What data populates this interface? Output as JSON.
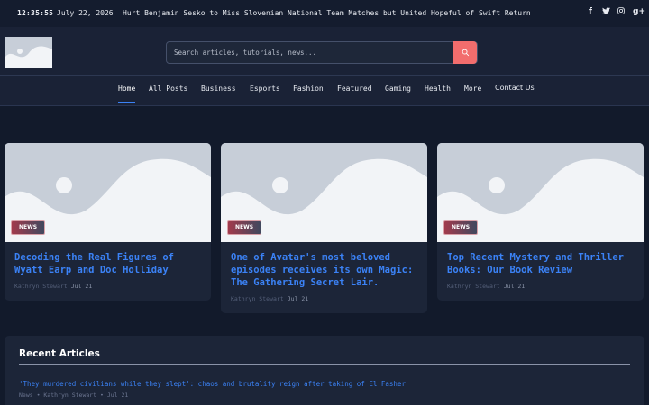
{
  "topbar": {
    "clock": "12:35:55",
    "date": "July 22, 2026",
    "ticker": "Hurt Benjamin Sesko to Miss Slovenian National Team Matches but United Hopeful of Swift Return",
    "social": [
      "f",
      "t",
      "ig",
      "g+"
    ]
  },
  "search": {
    "placeholder": "Search articles, tutorials, news..."
  },
  "nav": {
    "items": [
      "Home",
      "All Posts",
      "Business",
      "Esports",
      "Fashion",
      "Featured",
      "Gaming",
      "Health",
      "More",
      "Contact Us"
    ],
    "active": "Home"
  },
  "cards": [
    {
      "badge": "NEWS",
      "title": "Decoding the Real Figures of Wyatt Earp and Doc Holliday",
      "author": "Kathryn Stewart",
      "date": "Jul 21"
    },
    {
      "badge": "NEWS",
      "title": "One of Avatar's most beloved episodes receives its own Magic: The Gathering Secret Lair.",
      "author": "Kathryn Stewart",
      "date": "Jul 21"
    },
    {
      "badge": "NEWS",
      "title": "Top Recent Mystery and Thriller Books: Our Book Review",
      "author": "Kathryn Stewart",
      "date": "Jul 21"
    }
  ],
  "recent": {
    "title": "Recent Articles",
    "items": [
      {
        "title": "'They murdered civilians while they slept': chaos and brutality reign after taking of El Fasher",
        "meta": "News • Kathryn Stewart • Jul 21"
      }
    ]
  },
  "colors": {
    "accent": "#3b82f6",
    "search_button": "#f26d6d",
    "background": "#121a2b"
  }
}
